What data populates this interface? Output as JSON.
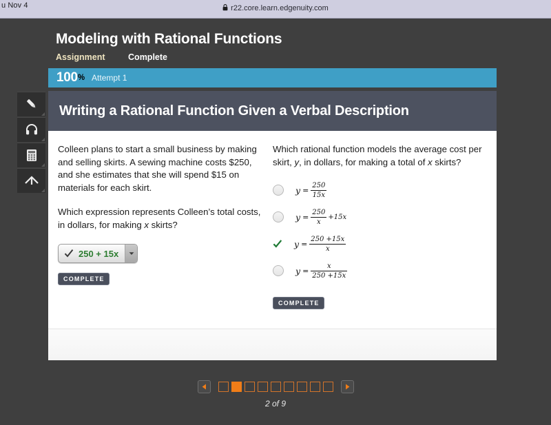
{
  "browser": {
    "clock": "u Nov 4",
    "lock_icon": "lock-icon",
    "url": "r22.core.learn.edgenuity.com"
  },
  "tools": [
    {
      "name": "pencil-tool",
      "icon": "pencil-icon"
    },
    {
      "name": "audio-tool",
      "icon": "headphones-icon"
    },
    {
      "name": "calculator-tool",
      "icon": "calculator-icon"
    },
    {
      "name": "collapse-tool",
      "icon": "arrow-up-icon"
    }
  ],
  "lesson": {
    "title": "Modeling with Rational Functions",
    "type": "Assignment",
    "status": "Complete",
    "score": "100",
    "score_symbol": "%",
    "attempt": "Attempt 1",
    "accent_color": "#3f9fc6"
  },
  "activity": {
    "header": "Writing a Rational Function Given a Verbal Description",
    "left": {
      "passage": "Colleen plans to start a small business by making and selling skirts. A sewing machine costs $250, and she estimates that she will spend $15 on materials for each skirt.",
      "question_pre": "Which expression represents Colleen’s total costs, in dollars, for making ",
      "question_var": "x",
      "question_post": " skirts?",
      "answer_value": "250 + 15x",
      "check_icon": "check-icon",
      "caret_icon": "chevron-down-icon",
      "complete_label": "COMPLETE"
    },
    "right": {
      "question_a": "Which rational function models the average cost per skirt, ",
      "question_var1": "y",
      "question_b": ", in dollars, for making a total of ",
      "question_var2": "x",
      "question_c": " skirts?",
      "lhs": "y",
      "eq": "=",
      "options": [
        {
          "numerator": "250",
          "denominator": "15x",
          "tail": "",
          "selected": false,
          "icon": "radio-unselected-icon"
        },
        {
          "numerator": "250",
          "denominator": "x",
          "tail": "+15x",
          "selected": false,
          "icon": "radio-unselected-icon"
        },
        {
          "numerator": "250 +15x",
          "denominator": "x",
          "tail": "",
          "selected": true,
          "icon": "check-icon"
        },
        {
          "numerator": "x",
          "denominator": "250 +15x",
          "tail": "",
          "selected": false,
          "icon": "radio-unselected-icon"
        }
      ],
      "complete_label": "COMPLETE"
    }
  },
  "pager": {
    "prev_icon": "triangle-left-icon",
    "next_icon": "triangle-right-icon",
    "dots": [
      false,
      true,
      false,
      false,
      false,
      false,
      false,
      false,
      false
    ],
    "label": "2 of 9",
    "active_color": "#f07d18"
  }
}
